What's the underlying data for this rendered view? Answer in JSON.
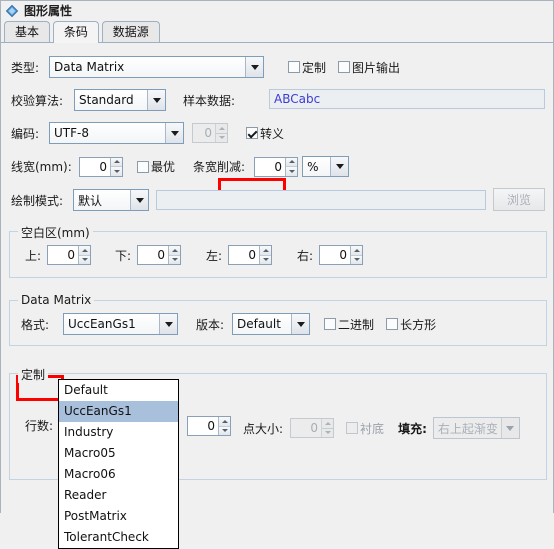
{
  "window": {
    "title": "图形属性",
    "icon": "properties-icon"
  },
  "tabs": [
    {
      "label": "基本",
      "selected": false
    },
    {
      "label": "条码",
      "selected": true
    },
    {
      "label": "数据源",
      "selected": false
    }
  ],
  "form": {
    "type_label": "类型:",
    "type_value": "Data Matrix",
    "custom_checkbox": "定制",
    "image_output_checkbox": "图片输出",
    "checksum_label": "校验算法:",
    "checksum_value": "Standard",
    "sample_label": "样本数据:",
    "sample_value": "ABCabc",
    "encoding_label": "编码:",
    "encoding_value": "UTF-8",
    "encoding_spin_value": "0",
    "escape_checkbox": "转义",
    "linewidth_label": "线宽(mm):",
    "linewidth_value": "0",
    "optimal_checkbox": "最优",
    "barwidth_label": "条宽削减:",
    "barwidth_value": "0",
    "barwidth_unit": "%",
    "drawmode_label": "绘制模式:",
    "drawmode_value": "默认",
    "drawmode_path": "",
    "browse_button": "浏览"
  },
  "quiet_zone": {
    "title": "空白区(mm)",
    "fields": [
      {
        "label": "上:",
        "value": "0"
      },
      {
        "label": "下:",
        "value": "0"
      },
      {
        "label": "左:",
        "value": "0"
      },
      {
        "label": "右:",
        "value": "0"
      }
    ]
  },
  "datamatrix": {
    "title": "Data Matrix",
    "format_label": "格式:",
    "format_value": "UccEanGs1",
    "version_label": "版本:",
    "version_value": "Default",
    "binary_checkbox": "二进制",
    "rect_checkbox": "长方形",
    "format_options": [
      "Default",
      "UccEanGs1",
      "Industry",
      "Macro05",
      "Macro06",
      "Reader",
      "PostMatrix",
      "TolerantCheck"
    ],
    "format_selected_index": 1
  },
  "custom_group": {
    "title": "定制",
    "rows_label": "行数:",
    "rows_value": "0",
    "dotsize_label": "点大小:",
    "dotsize_value": "0",
    "backing_checkbox": "衬底",
    "fill_label": "填充:",
    "fill_value": "右上起渐变"
  },
  "colors": {
    "highlight_red": "#fd0000",
    "selection_blue": "#a8c0dc",
    "sample_text_blue": "#3b3bd6",
    "panel_bg": "#f0f0f0"
  }
}
